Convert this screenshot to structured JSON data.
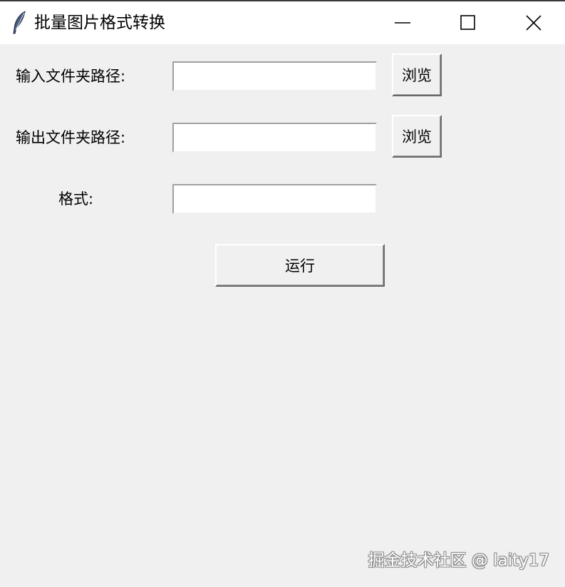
{
  "window": {
    "title": "批量图片格式转换",
    "icon": "feather-icon"
  },
  "form": {
    "input_folder_label": "输入文件夹路径:",
    "input_folder_value": "",
    "output_folder_label": "输出文件夹路径:",
    "output_folder_value": "",
    "format_label": "格式:",
    "format_value": "",
    "browse_label": "浏览",
    "run_label": "运行"
  },
  "watermark": "掘金技术社区 @ laity17"
}
